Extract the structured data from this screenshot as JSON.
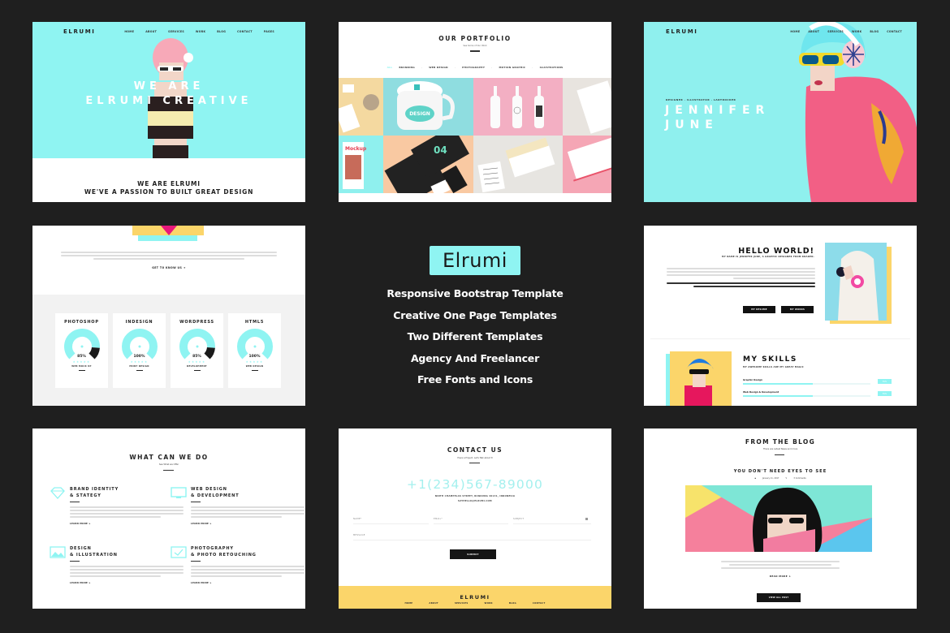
{
  "colors": {
    "background": "#1f1f1f",
    "accent_cyan": "#8ff4f2",
    "accent_yellow": "#fbd56a",
    "accent_pink": "#f5809c",
    "dark": "#151515"
  },
  "brand": "ELRUMI",
  "home_hero": {
    "nav": [
      "HOME",
      "ABOUT",
      "SERVICES",
      "WORK",
      "BLOG",
      "CONTACT",
      "PAGES"
    ],
    "title_line1": "WE ARE",
    "title_line2": "ELRUMI CREATIVE",
    "tagline_line1": "WE ARE ELRUMI",
    "tagline_line2": "WE'VE A PASSION TO BUILT GREAT DESIGN"
  },
  "portfolio": {
    "title": "OUR PORTFOLIO",
    "subtitle": "See Some of Our Work",
    "filters": [
      "ALL",
      "BRANDING",
      "WEB DESIGN",
      "PHOTOGRAPHY",
      "MOTION GRAPHIC",
      "ILLUSTRATIONS"
    ],
    "active_filter": "ALL",
    "tiles": [
      {
        "name": "stationery-kit",
        "color": "#f4d9a0"
      },
      {
        "name": "mug-mockup",
        "color": "#8fdde0",
        "label": "DESIGN"
      },
      {
        "name": "bottle-mockup",
        "color": "#f3afc3"
      },
      {
        "name": "letterhead",
        "color": "#e8e4df"
      },
      {
        "name": "magazine-mockup",
        "color": "#8ff0ee",
        "label": "Mockup"
      },
      {
        "name": "business-card-dark",
        "color": "#f9c9a2",
        "label": "04"
      },
      {
        "name": "business-card-stack",
        "color": "#e7e5e1"
      },
      {
        "name": "card-pink",
        "color": "#f5a6b5"
      }
    ]
  },
  "personal_hero": {
    "nav": [
      "HOME",
      "ABOUT",
      "SERVICES",
      "WORK",
      "BLOG",
      "CONTACT"
    ],
    "roles": "DESIGNER · ILLUSTRATOR · LADYROCKER",
    "name_line1": "JENNIFER",
    "name_line2": "JUNE"
  },
  "skills_section": {
    "cta": "GET TO KNOW US ➜",
    "cards": [
      {
        "title": "PHOTOSHOP",
        "percent": 85,
        "caption": "WEB MOCK UP"
      },
      {
        "title": "INDESIGN",
        "percent": 100,
        "caption": "PRINT DESIGN"
      },
      {
        "title": "WORDPRESS",
        "percent": 85,
        "caption": "DEVELOPMENT"
      },
      {
        "title": "HTML5",
        "percent": 100,
        "caption": "WEB DESIGN"
      }
    ],
    "stars": "★★★★★"
  },
  "promo": {
    "brand_box": "Elrumi",
    "features": [
      "Responsive Bootstrap Template",
      "Creative One Page Templates",
      "Two Different Templates",
      "Agency And Freelancer",
      "Free Fonts and Icons"
    ]
  },
  "about": {
    "title": "HELLO WORLD!",
    "subtitle": "MY NAME IS JENNIFER JUNE, A GRAPHIC DESIGNER FROM KRAKEN.",
    "buttons": [
      "MY RESUME",
      "MY WORKS"
    ],
    "skills_title": "MY SKILLS",
    "skills_subtitle": "MY AWESOME SKILLS ARE MY GREAT MAGIC",
    "skills": [
      {
        "label": "Graphic Design",
        "percent": 55
      },
      {
        "label": "Web Design & Development",
        "percent": 55
      }
    ]
  },
  "services": {
    "title": "WHAT CAN WE DO",
    "subtitle": "See What we Offer",
    "learn_more": "LEARN MORE ➤",
    "items": [
      {
        "icon": "diamond-icon",
        "line1": "BRAND IDENTITY",
        "line2": "& STATEGY"
      },
      {
        "icon": "monitor-icon",
        "line1": "WEB DESIGN",
        "line2": "& DEVELOPMENT"
      },
      {
        "icon": "image-icon",
        "line1": "DESIGN",
        "line2": "& ILLUSTRATION"
      },
      {
        "icon": "photo-icon",
        "line1": "PHOTOGRAPHY",
        "line2": "& PHOTO RETOUCHING"
      }
    ]
  },
  "contact": {
    "title": "CONTACT US",
    "subtitle": "Have a Project, Let's Talk about It",
    "phone": "+1(234)567-89000",
    "address": "NINTH CHAMPELAS STREET, BANDUNG 40131, INDONESIA",
    "email": "SAYHELLO@ELRUMI.COM",
    "fields": {
      "name": "NAME*",
      "email": "EMAIL*",
      "subject": "SUBJECT",
      "message": "MESSAGE"
    },
    "submit": "SUBMIT",
    "footer_logo": "ELRUMI",
    "footer_nav": [
      "HOME",
      "ABOUT",
      "SERVICES",
      "WORK",
      "BLOG",
      "CONTACT"
    ]
  },
  "blog": {
    "title": "FROM THE BLOG",
    "subtitle": "There are Latest News and more",
    "post_title": "YOU DON'T NEED EYES TO SEE",
    "date": "January 11, 2017",
    "comments": "3 Comments",
    "read_more": "READ MORE ➤",
    "view_all": "VIEW ALL POST"
  }
}
